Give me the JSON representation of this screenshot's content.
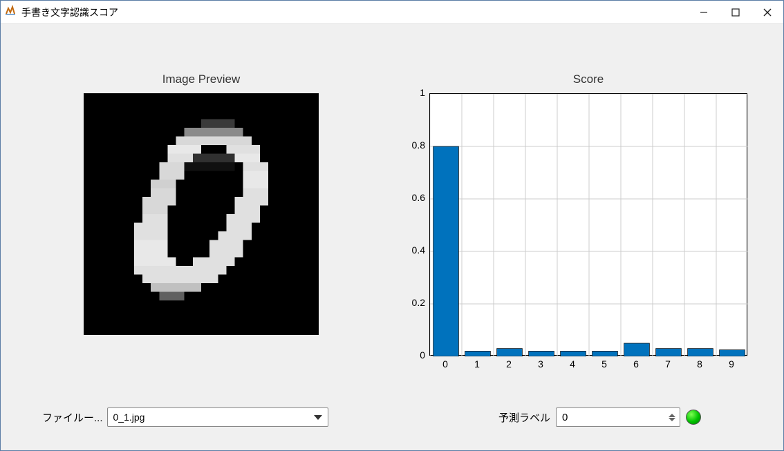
{
  "window": {
    "title": "手書き文字認識スコア"
  },
  "left": {
    "title": "Image Preview",
    "file_label": "ファイルー...",
    "file_value": "0_1.jpg"
  },
  "right": {
    "title": "Score",
    "pred_label": "予測ラベル",
    "pred_value": "0"
  },
  "chart_data": {
    "type": "bar",
    "categories": [
      "0",
      "1",
      "2",
      "3",
      "4",
      "5",
      "6",
      "7",
      "8",
      "9"
    ],
    "values": [
      0.8,
      0.02,
      0.03,
      0.02,
      0.02,
      0.02,
      0.05,
      0.03,
      0.03,
      0.025
    ],
    "title": "Score",
    "xlabel": "",
    "ylabel": "",
    "ylim": [
      0,
      1.0
    ],
    "yticks": [
      0,
      0.2,
      0.4,
      0.6,
      0.8,
      1.0
    ],
    "grid": true
  }
}
